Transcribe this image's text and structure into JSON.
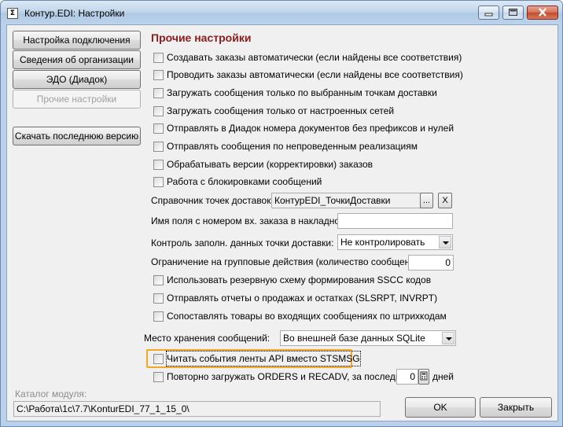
{
  "window": {
    "title": "Контур.EDI: Настройки",
    "icon": "app-icon"
  },
  "sidebar": {
    "buttons": [
      {
        "label": "Настройка подключения"
      },
      {
        "label": "Сведения об организации"
      },
      {
        "label": "ЭДО (Диадок)"
      },
      {
        "label": "Прочие настройки",
        "disabled": true
      }
    ],
    "download_label": "Скачать последнюю версию"
  },
  "main": {
    "section_title": "Прочие настройки",
    "checkboxes_top": [
      "Создавать заказы автоматически (если найдены все соответствия)",
      "Проводить заказы автоматически (если найдены все соответствия)",
      "Загружать сообщения только по выбранным точкам доставки",
      "Загружать сообщения только от настроенных сетей",
      "Отправлять в Диадок номера документов без префиксов и нулей",
      "Отправлять сообщения по непроведенным реализациям",
      "Обрабатывать версии (корректировки) заказов",
      "Работа с блокировками сообщений"
    ],
    "delivery_points": {
      "label": "Справочник точек доставок:",
      "value": "КонтурEDI_ТочкиДоставки",
      "browse": "...",
      "clear": "X"
    },
    "order_field": {
      "label": "Имя поля с номером вх. заказа в накладной:",
      "value": ""
    },
    "control": {
      "label": "Контроль заполн. данных точки доставки:",
      "value": "Не контролировать"
    },
    "limit": {
      "label": "Ограничение на групповые действия (количество сообщений):",
      "value": "0"
    },
    "checkboxes_mid": [
      "Иcпользовать резервную схему формирования SSCC кодов",
      "Отправлять отчеты о продажах и остатках (SLSRPT, INVRPT)",
      "Сопоставлять товары во входящих сообщениях по штрихкодам"
    ],
    "storage": {
      "label": "Место хранения сообщений:",
      "value": "Во внешней базе данных SQLite"
    },
    "api_checkbox": "Читать события ленты API вместо STSMSG",
    "reload": {
      "label": "Повторно загружать ORDERS и RECADV, за последние",
      "value": "0",
      "unit": "дней"
    }
  },
  "footer": {
    "module_label": "Каталог модуля:",
    "module_path": "C:\\Работа\\1с\\7.7\\KonturEDI_77_1_15_0\\",
    "ok": "OK",
    "close": "Закрыть"
  }
}
